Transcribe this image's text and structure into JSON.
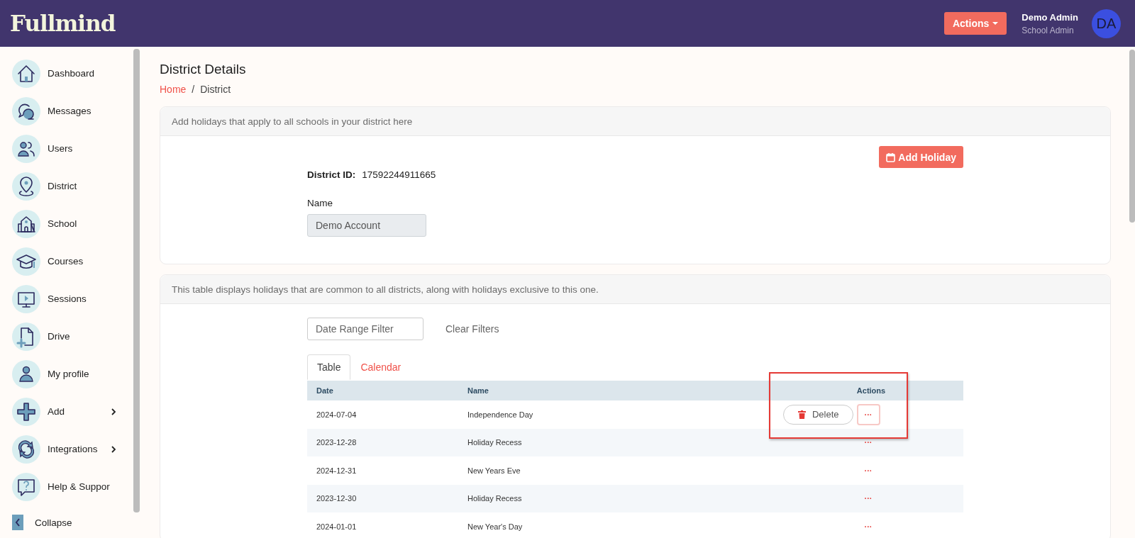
{
  "header": {
    "logo": "Fullmind",
    "actions_button": "Actions",
    "user": {
      "name": "Demo Admin",
      "role": "School Admin",
      "initials": "DA"
    }
  },
  "sidebar": {
    "items": [
      {
        "label": "Dashboard",
        "expandable": false
      },
      {
        "label": "Messages",
        "expandable": false
      },
      {
        "label": "Users",
        "expandable": false
      },
      {
        "label": "District",
        "expandable": false
      },
      {
        "label": "School",
        "expandable": false
      },
      {
        "label": "Courses",
        "expandable": false
      },
      {
        "label": "Sessions",
        "expandable": false
      },
      {
        "label": "Drive",
        "expandable": false
      },
      {
        "label": "My profile",
        "expandable": false
      },
      {
        "label": "Add",
        "expandable": true
      },
      {
        "label": "Integrations",
        "expandable": true
      },
      {
        "label": "Help & Suppor",
        "expandable": false
      }
    ],
    "collapse": "Collapse"
  },
  "page": {
    "title": "District Details",
    "breadcrumb": [
      {
        "label": "Home",
        "link": true
      },
      {
        "label": "District",
        "link": false
      }
    ],
    "separator": "/"
  },
  "district_card": {
    "header": "Add holidays that apply to all schools in your district here",
    "add_button": "Add Holiday",
    "id_label": "District ID:",
    "id_value": "17592244911665",
    "name_label": "Name",
    "name_value": "Demo Account"
  },
  "holidays_card": {
    "header": "This table displays holidays that are common to all districts, along with holidays exclusive to this one.",
    "filter_placeholder": "Date Range Filter",
    "clear_filters": "Clear Filters",
    "tabs": [
      {
        "label": "Table",
        "selected": true
      },
      {
        "label": "Calendar",
        "selected": false
      }
    ],
    "table": {
      "columns": [
        "Date",
        "Name",
        "Actions"
      ],
      "actions_highlighted": true,
      "rows": [
        {
          "date": "2024-07-04",
          "name": "Independence Day",
          "more": "···",
          "menu_open": true,
          "menu_items": [
            {
              "label": "Delete"
            }
          ]
        },
        {
          "date": "2023-12-28",
          "name": "Holiday Recess",
          "more": "···",
          "menu_open": false
        },
        {
          "date": "2024-12-31",
          "name": "New Years Eve",
          "more": "···",
          "menu_open": false
        },
        {
          "date": "2023-12-30",
          "name": "Holiday Recess",
          "more": "···",
          "menu_open": false
        },
        {
          "date": "2024-01-01",
          "name": "New Year's Day",
          "more": "···",
          "menu_open": false
        }
      ]
    }
  }
}
